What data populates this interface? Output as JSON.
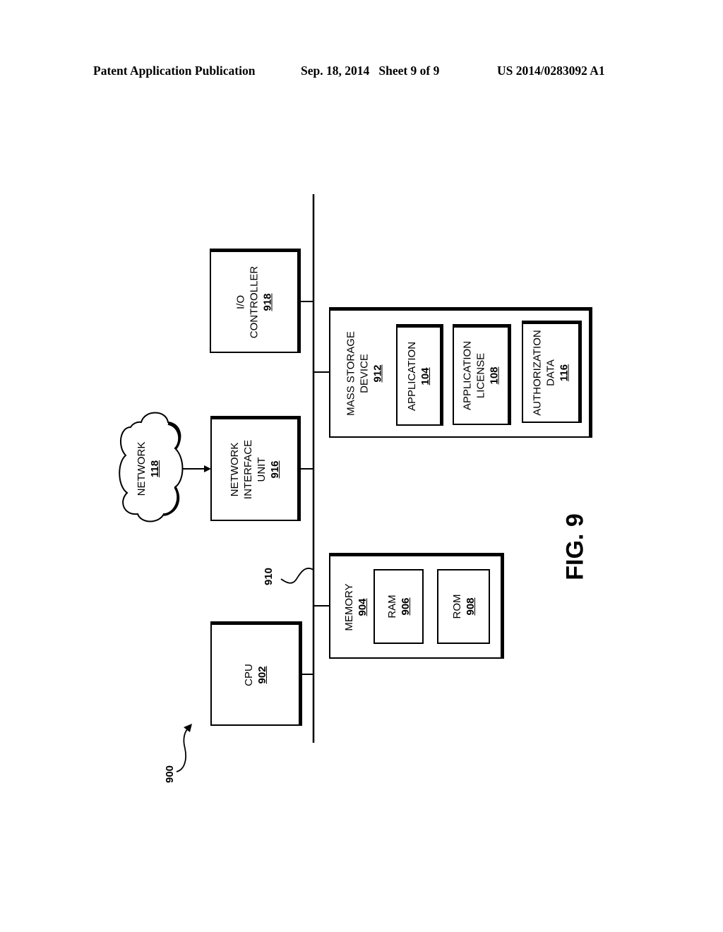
{
  "header": {
    "publication": "Patent Application Publication",
    "date_sheet": "Sep. 18, 2014   Sheet 9 of 9",
    "number": "US 2014/0283092 A1"
  },
  "figure": {
    "label": "FIG. 9",
    "system_ref": "900",
    "bus_ref": "910",
    "cpu": {
      "name": "CPU",
      "ref": "902"
    },
    "memory": {
      "name": "MEMORY",
      "ref": "904",
      "ram": {
        "name": "RAM",
        "ref": "906"
      },
      "rom": {
        "name": "ROM",
        "ref": "908"
      }
    },
    "mass_storage": {
      "name_line1": "MASS STORAGE",
      "name_line2": "DEVICE",
      "ref": "912",
      "items": [
        {
          "line1": "APPLICATION",
          "line2": "",
          "ref": "104"
        },
        {
          "line1": "APPLICATION",
          "line2": "LICENSE",
          "ref": "108"
        },
        {
          "line1": "AUTHORIZATION",
          "line2": "DATA",
          "ref": "116"
        }
      ]
    },
    "network_interface": {
      "line1": "NETWORK",
      "line2": "INTERFACE",
      "line3": "UNIT",
      "ref": "916"
    },
    "io_controller": {
      "line1": "I/O",
      "line2": "CONTROLLER",
      "ref": "918"
    },
    "network": {
      "name": "NETWORK",
      "ref": "118"
    }
  }
}
